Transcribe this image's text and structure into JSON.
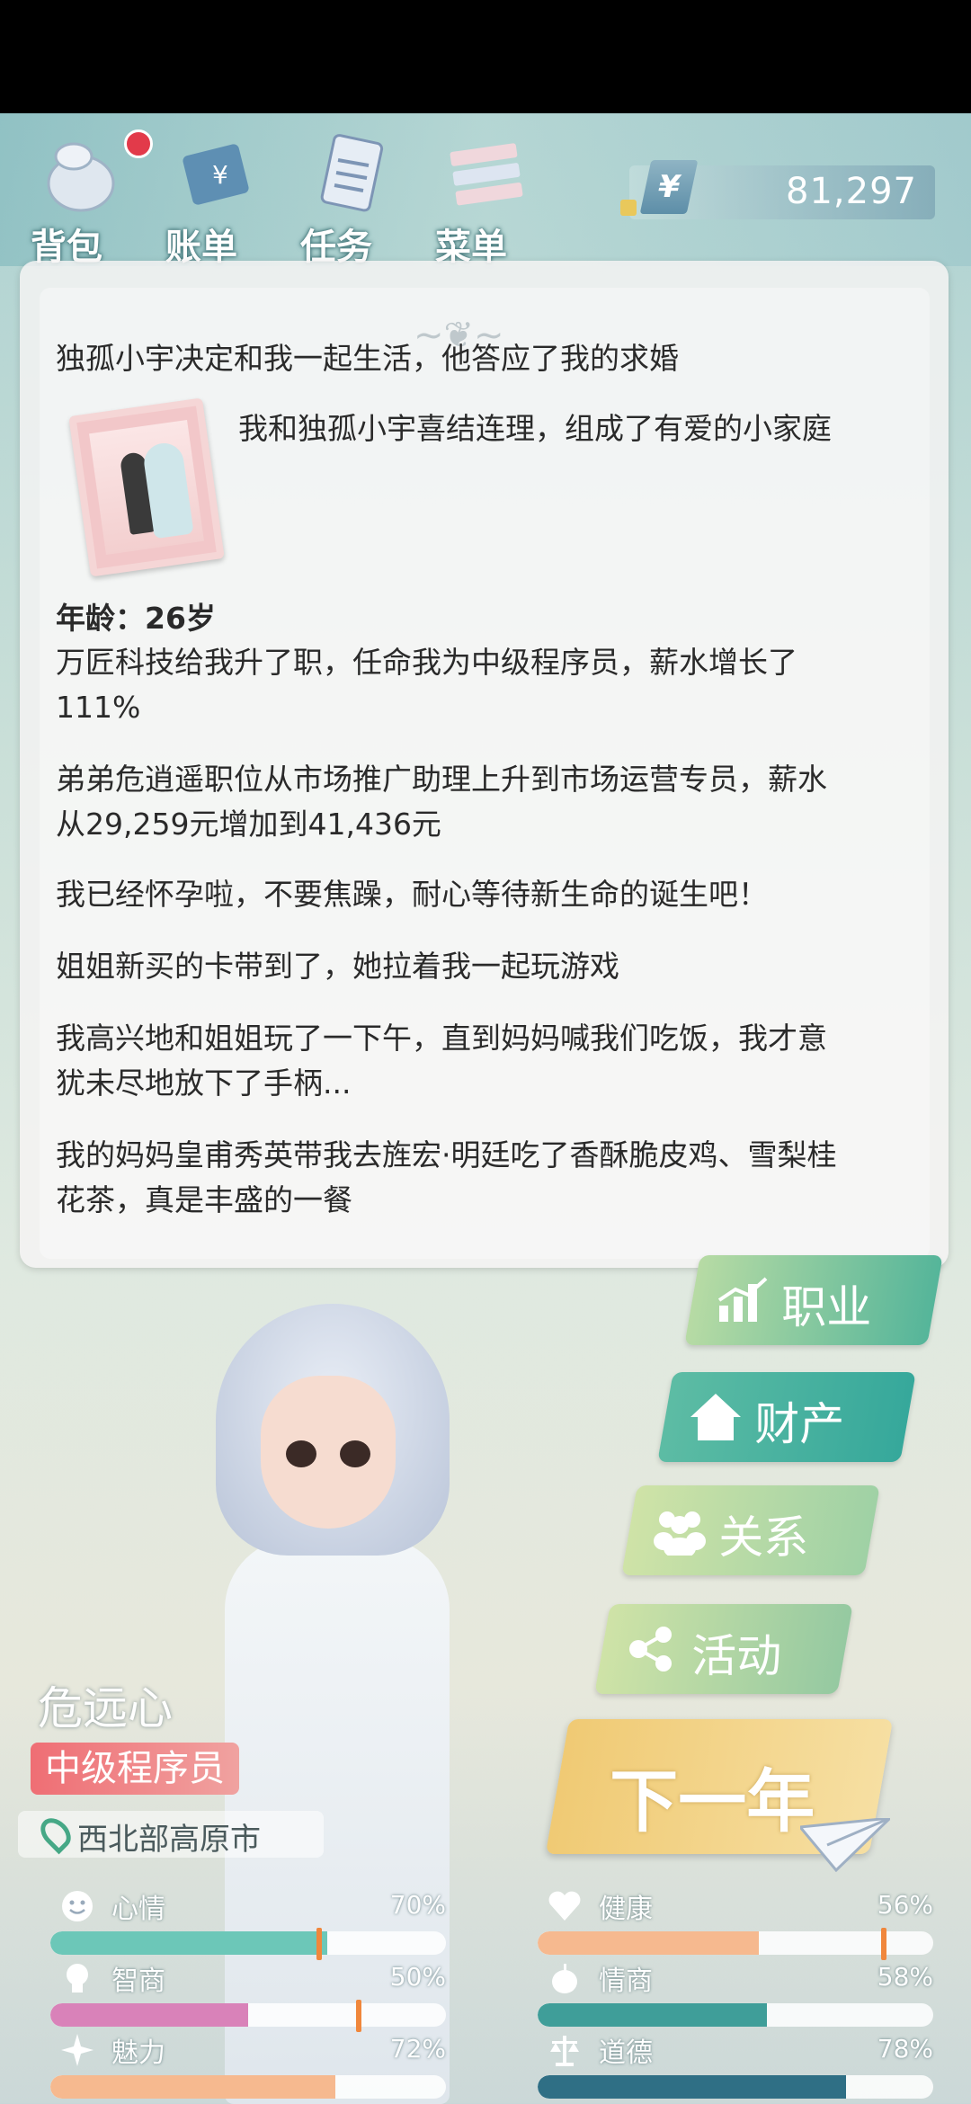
{
  "nav": {
    "items": [
      {
        "label": "背包",
        "icon": "backpack-icon",
        "has_badge": true
      },
      {
        "label": "账单",
        "icon": "bill-icon",
        "has_badge": false
      },
      {
        "label": "任务",
        "icon": "task-icon",
        "has_badge": false
      },
      {
        "label": "菜单",
        "icon": "menu-icon",
        "has_badge": false
      }
    ],
    "currency_symbol": "¥",
    "money": "81,297"
  },
  "log": {
    "event1": "独孤小宇决定和我一起生活，他答应了我的求婚",
    "event2": "我和独孤小宇喜结连理，组成了有爱的小家庭",
    "age": "年龄：26岁",
    "line1a": "万匠科技给我升了职，任命我为中级程序员，薪水增长了",
    "line1b": "111%",
    "line2a": "弟弟危逍遥职位从市场推广助理上升到市场运营专员，薪水",
    "line2b": "从29,259元增加到41,436元",
    "line3": "我已经怀孕啦，不要焦躁，耐心等待新生命的诞生吧！",
    "line4": "姐姐新买的卡带到了，她拉着我一起玩游戏",
    "line5a": "我高兴地和姐姐玩了一下午，直到妈妈喊我们吃饭，我才意",
    "line5b": "犹未尽地放下了手柄...",
    "line6a": "我的妈妈皇甫秀英带我去旌宏·明廷吃了香酥脆皮鸡、雪梨桂",
    "line6b": "花茶，真是丰盛的一餐"
  },
  "character": {
    "name": "危远心",
    "job": "中级程序员",
    "location": "西北部高原市"
  },
  "menu": {
    "career": "职业",
    "assets": "财产",
    "relation": "关系",
    "activity": "活动",
    "next_year": "下一年"
  },
  "stats": [
    {
      "name": "心情",
      "value": "70%",
      "fraction": 0.7,
      "icon": "smile-icon",
      "color": "#6cc7b8"
    },
    {
      "name": "健康",
      "value": "56%",
      "fraction": 0.56,
      "icon": "heart-icon",
      "color": "#f6b98f"
    },
    {
      "name": "智商",
      "value": "50%",
      "fraction": 0.5,
      "icon": "bulb-icon",
      "color": "#d982b9"
    },
    {
      "name": "情商",
      "value": "58%",
      "fraction": 0.58,
      "icon": "apple-icon",
      "color": "#3f9e99"
    },
    {
      "name": "魅力",
      "value": "72%",
      "fraction": 0.72,
      "icon": "sparkle-icon",
      "color": "#f6b98f"
    },
    {
      "name": "道德",
      "value": "78%",
      "fraction": 0.78,
      "icon": "scale-icon",
      "color": "#2f6f85"
    }
  ]
}
